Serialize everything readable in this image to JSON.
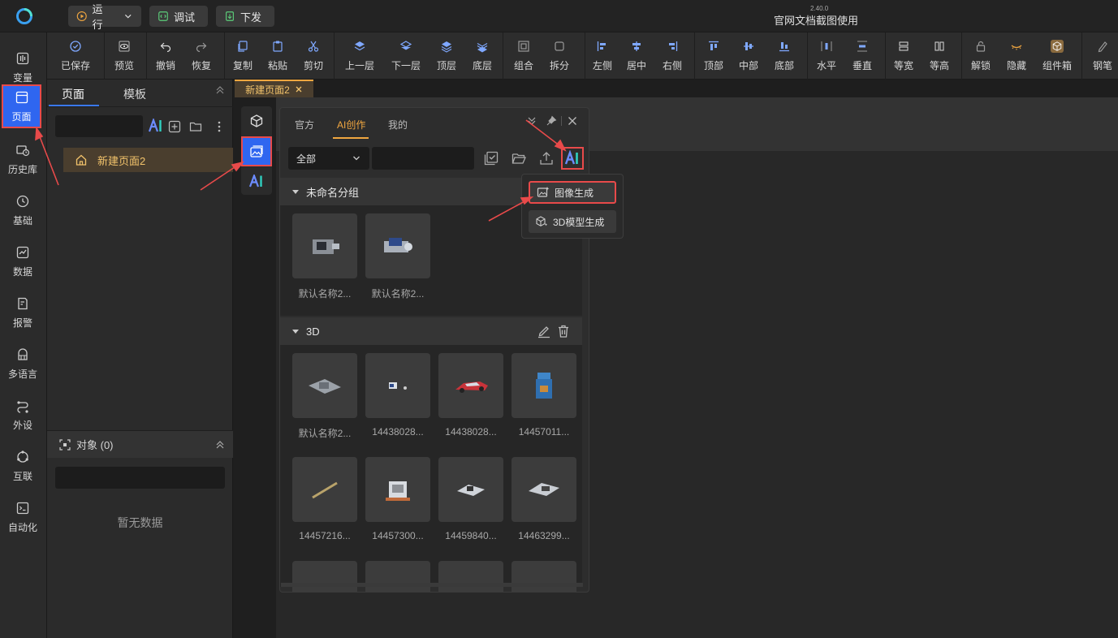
{
  "header": {
    "run_label": "运行",
    "debug_label": "调试",
    "deploy_label": "下发",
    "version": "2.40.0",
    "doc_title": "官网文档截图使用"
  },
  "toolbar": {
    "items": [
      "已保存",
      "预览",
      "撤销",
      "恢复",
      "复制",
      "粘贴",
      "剪切",
      "上一层",
      "下一层",
      "顶层",
      "底层",
      "组合",
      "拆分",
      "左侧",
      "居中",
      "右侧",
      "顶部",
      "中部",
      "底部",
      "水平",
      "垂直",
      "等宽",
      "等高",
      "解锁",
      "隐藏",
      "组件箱",
      "钢笔"
    ]
  },
  "leftnav": {
    "items": [
      "变量",
      "页面",
      "历史库",
      "基础",
      "数据",
      "报警",
      "多语言",
      "外设",
      "互联",
      "自动化"
    ],
    "active": "页面"
  },
  "pagepanel": {
    "tabs": [
      "页面",
      "模板"
    ],
    "search_placeholder": "",
    "tree_item": "新建页面2",
    "objects_header": "对象 (0)",
    "empty_text": "暂无数据"
  },
  "doc_tab": "新建页面2",
  "library": {
    "tabs": [
      "官方",
      "AI创作",
      "我的"
    ],
    "active_tab": "AI创作",
    "filter_value": "全部",
    "groups": [
      {
        "name": "未命名分组",
        "items": [
          "默认名称2...",
          "默认名称2..."
        ]
      },
      {
        "name": "3D",
        "items": [
          "默认名称2...",
          "14438028...",
          "14438028...",
          "14457011...",
          "14457216...",
          "14457300...",
          "14459840...",
          "14463299..."
        ]
      }
    ]
  },
  "ai_menu": {
    "items": [
      "图像生成",
      "3D模型生成"
    ]
  },
  "colors": {
    "accent_blue": "#2f66f0",
    "accent_orange": "#f0a640",
    "annotation_red": "#e84a4a"
  }
}
